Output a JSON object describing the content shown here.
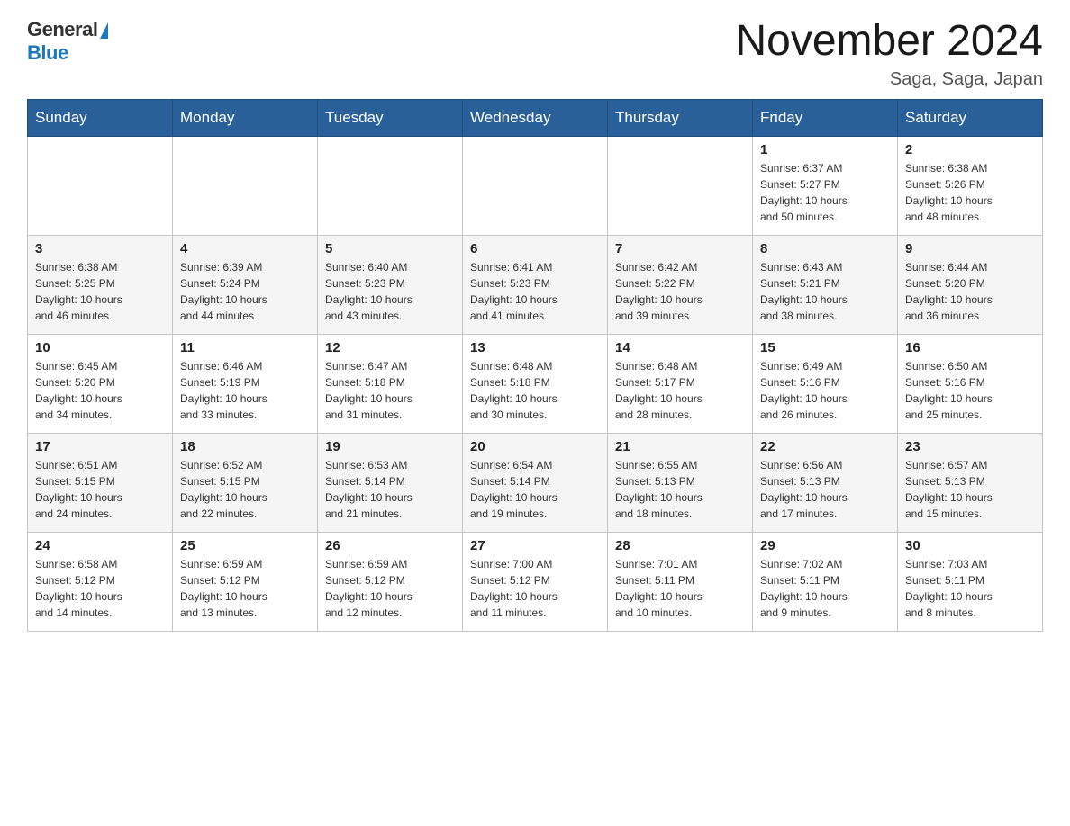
{
  "logo": {
    "general": "General",
    "blue": "Blue"
  },
  "title": "November 2024",
  "location": "Saga, Saga, Japan",
  "days_header": [
    "Sunday",
    "Monday",
    "Tuesday",
    "Wednesday",
    "Thursday",
    "Friday",
    "Saturday"
  ],
  "weeks": [
    [
      {
        "day": "",
        "info": ""
      },
      {
        "day": "",
        "info": ""
      },
      {
        "day": "",
        "info": ""
      },
      {
        "day": "",
        "info": ""
      },
      {
        "day": "",
        "info": ""
      },
      {
        "day": "1",
        "info": "Sunrise: 6:37 AM\nSunset: 5:27 PM\nDaylight: 10 hours\nand 50 minutes."
      },
      {
        "day": "2",
        "info": "Sunrise: 6:38 AM\nSunset: 5:26 PM\nDaylight: 10 hours\nand 48 minutes."
      }
    ],
    [
      {
        "day": "3",
        "info": "Sunrise: 6:38 AM\nSunset: 5:25 PM\nDaylight: 10 hours\nand 46 minutes."
      },
      {
        "day": "4",
        "info": "Sunrise: 6:39 AM\nSunset: 5:24 PM\nDaylight: 10 hours\nand 44 minutes."
      },
      {
        "day": "5",
        "info": "Sunrise: 6:40 AM\nSunset: 5:23 PM\nDaylight: 10 hours\nand 43 minutes."
      },
      {
        "day": "6",
        "info": "Sunrise: 6:41 AM\nSunset: 5:23 PM\nDaylight: 10 hours\nand 41 minutes."
      },
      {
        "day": "7",
        "info": "Sunrise: 6:42 AM\nSunset: 5:22 PM\nDaylight: 10 hours\nand 39 minutes."
      },
      {
        "day": "8",
        "info": "Sunrise: 6:43 AM\nSunset: 5:21 PM\nDaylight: 10 hours\nand 38 minutes."
      },
      {
        "day": "9",
        "info": "Sunrise: 6:44 AM\nSunset: 5:20 PM\nDaylight: 10 hours\nand 36 minutes."
      }
    ],
    [
      {
        "day": "10",
        "info": "Sunrise: 6:45 AM\nSunset: 5:20 PM\nDaylight: 10 hours\nand 34 minutes."
      },
      {
        "day": "11",
        "info": "Sunrise: 6:46 AM\nSunset: 5:19 PM\nDaylight: 10 hours\nand 33 minutes."
      },
      {
        "day": "12",
        "info": "Sunrise: 6:47 AM\nSunset: 5:18 PM\nDaylight: 10 hours\nand 31 minutes."
      },
      {
        "day": "13",
        "info": "Sunrise: 6:48 AM\nSunset: 5:18 PM\nDaylight: 10 hours\nand 30 minutes."
      },
      {
        "day": "14",
        "info": "Sunrise: 6:48 AM\nSunset: 5:17 PM\nDaylight: 10 hours\nand 28 minutes."
      },
      {
        "day": "15",
        "info": "Sunrise: 6:49 AM\nSunset: 5:16 PM\nDaylight: 10 hours\nand 26 minutes."
      },
      {
        "day": "16",
        "info": "Sunrise: 6:50 AM\nSunset: 5:16 PM\nDaylight: 10 hours\nand 25 minutes."
      }
    ],
    [
      {
        "day": "17",
        "info": "Sunrise: 6:51 AM\nSunset: 5:15 PM\nDaylight: 10 hours\nand 24 minutes."
      },
      {
        "day": "18",
        "info": "Sunrise: 6:52 AM\nSunset: 5:15 PM\nDaylight: 10 hours\nand 22 minutes."
      },
      {
        "day": "19",
        "info": "Sunrise: 6:53 AM\nSunset: 5:14 PM\nDaylight: 10 hours\nand 21 minutes."
      },
      {
        "day": "20",
        "info": "Sunrise: 6:54 AM\nSunset: 5:14 PM\nDaylight: 10 hours\nand 19 minutes."
      },
      {
        "day": "21",
        "info": "Sunrise: 6:55 AM\nSunset: 5:13 PM\nDaylight: 10 hours\nand 18 minutes."
      },
      {
        "day": "22",
        "info": "Sunrise: 6:56 AM\nSunset: 5:13 PM\nDaylight: 10 hours\nand 17 minutes."
      },
      {
        "day": "23",
        "info": "Sunrise: 6:57 AM\nSunset: 5:13 PM\nDaylight: 10 hours\nand 15 minutes."
      }
    ],
    [
      {
        "day": "24",
        "info": "Sunrise: 6:58 AM\nSunset: 5:12 PM\nDaylight: 10 hours\nand 14 minutes."
      },
      {
        "day": "25",
        "info": "Sunrise: 6:59 AM\nSunset: 5:12 PM\nDaylight: 10 hours\nand 13 minutes."
      },
      {
        "day": "26",
        "info": "Sunrise: 6:59 AM\nSunset: 5:12 PM\nDaylight: 10 hours\nand 12 minutes."
      },
      {
        "day": "27",
        "info": "Sunrise: 7:00 AM\nSunset: 5:12 PM\nDaylight: 10 hours\nand 11 minutes."
      },
      {
        "day": "28",
        "info": "Sunrise: 7:01 AM\nSunset: 5:11 PM\nDaylight: 10 hours\nand 10 minutes."
      },
      {
        "day": "29",
        "info": "Sunrise: 7:02 AM\nSunset: 5:11 PM\nDaylight: 10 hours\nand 9 minutes."
      },
      {
        "day": "30",
        "info": "Sunrise: 7:03 AM\nSunset: 5:11 PM\nDaylight: 10 hours\nand 8 minutes."
      }
    ]
  ]
}
